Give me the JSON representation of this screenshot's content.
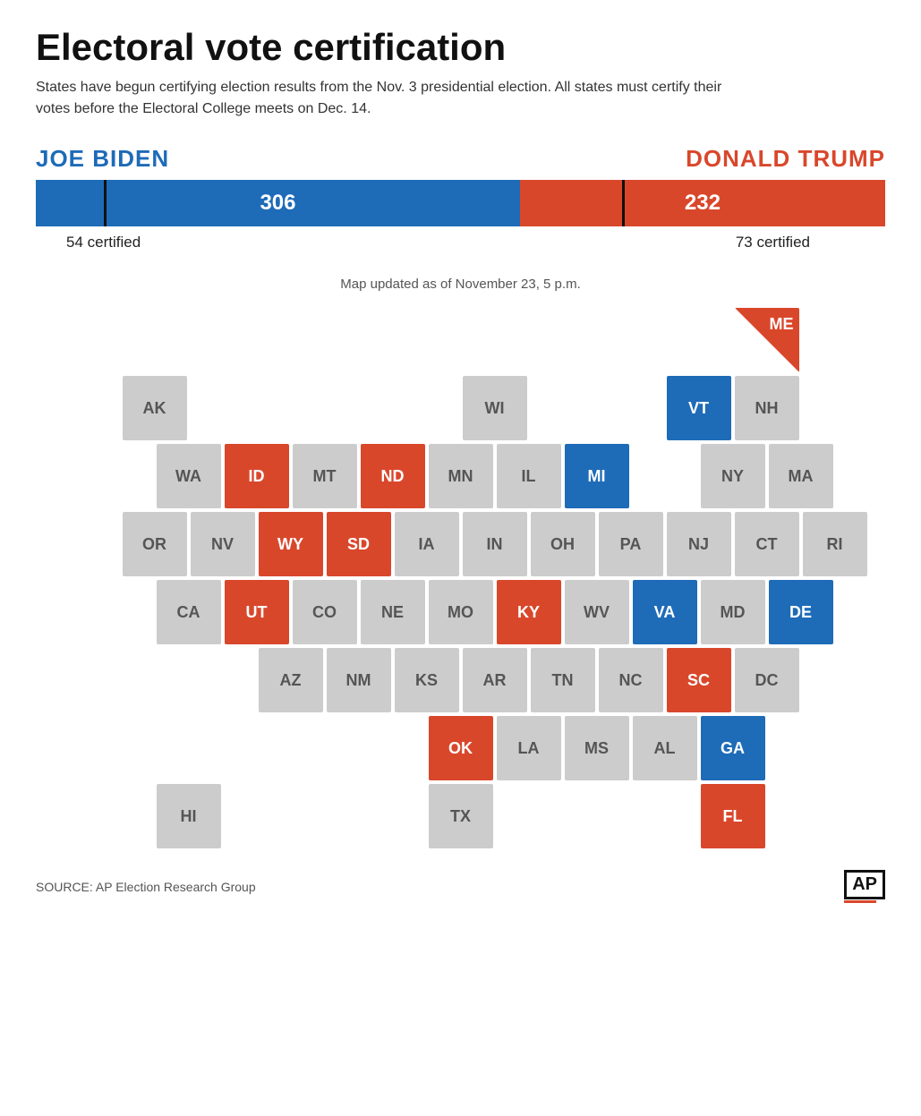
{
  "title": "Electoral vote certification",
  "subtitle": "States have begun certifying election results from the Nov. 3 presidential election. All states must certify their votes before the Electoral College meets on Dec. 14.",
  "biden": {
    "name": "JOE BIDEN",
    "votes": "306",
    "certified": "54 certified",
    "bar_pct": 57
  },
  "trump": {
    "name": "DONALD TRUMP",
    "votes": "232",
    "certified": "73 certified",
    "bar_pct": 43
  },
  "map_updated": "Map updated as of  November 23, 5 p.m.",
  "source": "SOURCE:  AP Election Research Group",
  "ap_logo": "AP",
  "states": {
    "row1": [
      {
        "abbr": "",
        "color": "empty"
      },
      {
        "abbr": "",
        "color": "empty"
      },
      {
        "abbr": "",
        "color": "empty"
      },
      {
        "abbr": "",
        "color": "empty"
      },
      {
        "abbr": "",
        "color": "empty"
      },
      {
        "abbr": "",
        "color": "empty"
      },
      {
        "abbr": "",
        "color": "empty"
      },
      {
        "abbr": "",
        "color": "empty"
      },
      {
        "abbr": "",
        "color": "empty"
      },
      {
        "abbr": "ME",
        "color": "red-corner"
      }
    ],
    "row2": [
      {
        "abbr": "AK",
        "color": "gray"
      },
      {
        "abbr": "",
        "color": "empty"
      },
      {
        "abbr": "",
        "color": "empty"
      },
      {
        "abbr": "",
        "color": "empty"
      },
      {
        "abbr": "",
        "color": "empty"
      },
      {
        "abbr": "WI",
        "color": "gray"
      },
      {
        "abbr": "",
        "color": "empty"
      },
      {
        "abbr": "",
        "color": "empty"
      },
      {
        "abbr": "VT",
        "color": "blue"
      },
      {
        "abbr": "NH",
        "color": "gray"
      }
    ],
    "row3": [
      {
        "abbr": "",
        "color": "empty"
      },
      {
        "abbr": "WA",
        "color": "gray"
      },
      {
        "abbr": "ID",
        "color": "red"
      },
      {
        "abbr": "MT",
        "color": "gray"
      },
      {
        "abbr": "ND",
        "color": "red"
      },
      {
        "abbr": "MN",
        "color": "gray"
      },
      {
        "abbr": "IL",
        "color": "gray"
      },
      {
        "abbr": "MI",
        "color": "blue"
      },
      {
        "abbr": "",
        "color": "empty"
      },
      {
        "abbr": "NY",
        "color": "gray"
      },
      {
        "abbr": "MA",
        "color": "gray"
      }
    ],
    "row4": [
      {
        "abbr": "",
        "color": "empty"
      },
      {
        "abbr": "OR",
        "color": "gray"
      },
      {
        "abbr": "NV",
        "color": "gray"
      },
      {
        "abbr": "WY",
        "color": "red"
      },
      {
        "abbr": "SD",
        "color": "red"
      },
      {
        "abbr": "IA",
        "color": "gray"
      },
      {
        "abbr": "IN",
        "color": "gray"
      },
      {
        "abbr": "OH",
        "color": "gray"
      },
      {
        "abbr": "PA",
        "color": "gray"
      },
      {
        "abbr": "NJ",
        "color": "gray"
      },
      {
        "abbr": "CT",
        "color": "gray"
      },
      {
        "abbr": "RI",
        "color": "gray"
      }
    ],
    "row5": [
      {
        "abbr": "",
        "color": "empty"
      },
      {
        "abbr": "CA",
        "color": "gray"
      },
      {
        "abbr": "UT",
        "color": "red"
      },
      {
        "abbr": "CO",
        "color": "gray"
      },
      {
        "abbr": "NE",
        "color": "gray"
      },
      {
        "abbr": "MO",
        "color": "gray"
      },
      {
        "abbr": "KY",
        "color": "red"
      },
      {
        "abbr": "WV",
        "color": "gray"
      },
      {
        "abbr": "VA",
        "color": "blue"
      },
      {
        "abbr": "MD",
        "color": "gray"
      },
      {
        "abbr": "DE",
        "color": "blue"
      }
    ],
    "row6": [
      {
        "abbr": "",
        "color": "empty"
      },
      {
        "abbr": "",
        "color": "empty"
      },
      {
        "abbr": "AZ",
        "color": "gray"
      },
      {
        "abbr": "NM",
        "color": "gray"
      },
      {
        "abbr": "KS",
        "color": "gray"
      },
      {
        "abbr": "AR",
        "color": "gray"
      },
      {
        "abbr": "TN",
        "color": "gray"
      },
      {
        "abbr": "NC",
        "color": "gray"
      },
      {
        "abbr": "SC",
        "color": "red"
      },
      {
        "abbr": "DC",
        "color": "gray"
      }
    ],
    "row7": [
      {
        "abbr": "",
        "color": "empty"
      },
      {
        "abbr": "",
        "color": "empty"
      },
      {
        "abbr": "",
        "color": "empty"
      },
      {
        "abbr": "",
        "color": "empty"
      },
      {
        "abbr": "OK",
        "color": "red"
      },
      {
        "abbr": "LA",
        "color": "gray"
      },
      {
        "abbr": "MS",
        "color": "gray"
      },
      {
        "abbr": "AL",
        "color": "gray"
      },
      {
        "abbr": "GA",
        "color": "blue"
      }
    ],
    "row8": [
      {
        "abbr": "HI",
        "color": "gray"
      },
      {
        "abbr": "",
        "color": "empty"
      },
      {
        "abbr": "",
        "color": "empty"
      },
      {
        "abbr": "",
        "color": "empty"
      },
      {
        "abbr": "TX",
        "color": "gray"
      },
      {
        "abbr": "",
        "color": "empty"
      },
      {
        "abbr": "",
        "color": "empty"
      },
      {
        "abbr": "",
        "color": "empty"
      },
      {
        "abbr": "FL",
        "color": "red"
      }
    ]
  }
}
